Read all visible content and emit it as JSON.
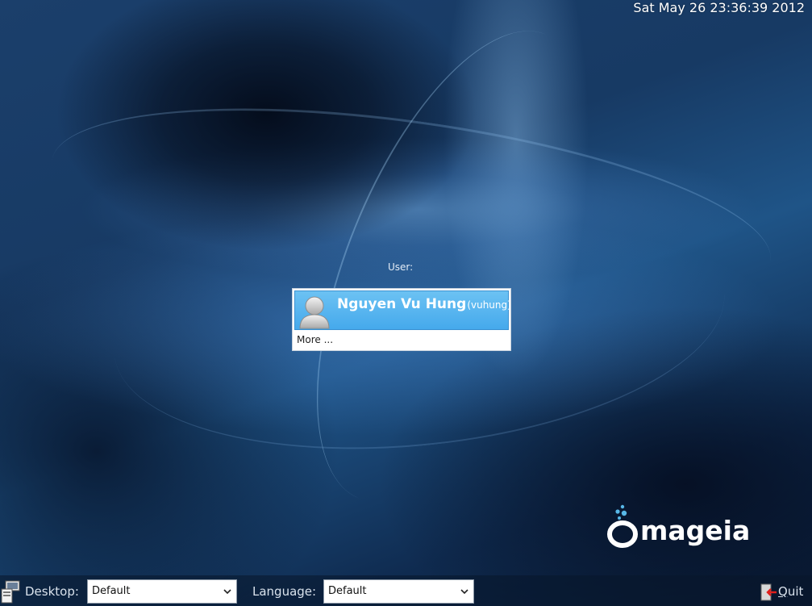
{
  "clock": "Sat May 26 23:36:39 2012",
  "login": {
    "user_caption": "User:",
    "users": [
      {
        "name": "Nguyen Vu Hung",
        "login": "(vuhung)"
      }
    ],
    "more_label": "More ..."
  },
  "brand": {
    "logo_text": "mageia"
  },
  "bottom_bar": {
    "desktop_label": "Desktop:",
    "desktop_value": "Default",
    "language_label": "Language:",
    "language_value": "Default",
    "quit_label": "Quit"
  },
  "colors": {
    "selection": "#4fb1ef",
    "background": "#173a64"
  }
}
